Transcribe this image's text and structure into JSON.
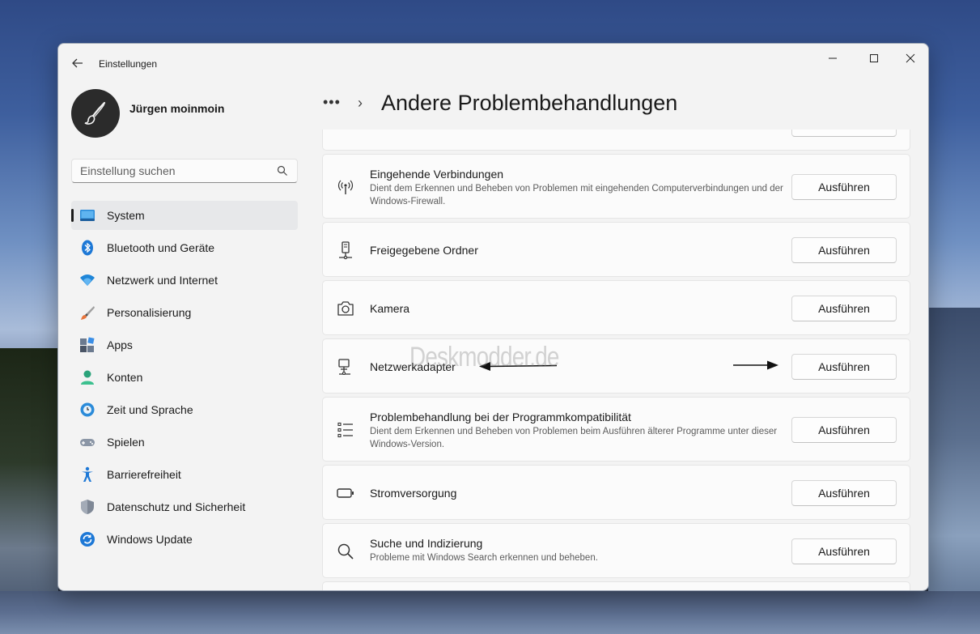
{
  "window": {
    "app_title": "Einstellungen",
    "controls": {
      "minimize": "—",
      "maximize": "☐",
      "close": "✕"
    }
  },
  "profile": {
    "name": "Jürgen moinmoin"
  },
  "search": {
    "placeholder": "Einstellung suchen"
  },
  "nav": {
    "items": [
      {
        "label": "System",
        "icon": "system-icon",
        "selected": true
      },
      {
        "label": "Bluetooth und Geräte",
        "icon": "bluetooth-icon"
      },
      {
        "label": "Netzwerk und Internet",
        "icon": "wifi-icon"
      },
      {
        "label": "Personalisierung",
        "icon": "brush-icon"
      },
      {
        "label": "Apps",
        "icon": "apps-icon"
      },
      {
        "label": "Konten",
        "icon": "account-icon"
      },
      {
        "label": "Zeit und Sprache",
        "icon": "clock-globe-icon"
      },
      {
        "label": "Spielen",
        "icon": "gamepad-icon"
      },
      {
        "label": "Barrierefreiheit",
        "icon": "accessibility-icon"
      },
      {
        "label": "Datenschutz und Sicherheit",
        "icon": "shield-icon"
      },
      {
        "label": "Windows Update",
        "icon": "update-icon"
      }
    ]
  },
  "header": {
    "breadcrumb_more": "•••",
    "breadcrumb_separator": "›",
    "title": "Andere Problembehandlungen"
  },
  "troubleshooters": [
    {
      "title": "Eingehende Verbindungen",
      "description": "Dient dem Erkennen und Beheben von Problemen mit eingehenden Computerverbindungen und der Windows-Firewall.",
      "icon": "antenna-icon",
      "button": "Ausführen"
    },
    {
      "title": "Freigegebene Ordner",
      "description": "",
      "icon": "shared-folder-icon",
      "button": "Ausführen"
    },
    {
      "title": "Kamera",
      "description": "",
      "icon": "camera-icon",
      "button": "Ausführen"
    },
    {
      "title": "Netzwerkadapter",
      "description": "",
      "icon": "network-adapter-icon",
      "button": "Ausführen"
    },
    {
      "title": "Problembehandlung bei der Programmkompatibilität",
      "description": "Dient dem Erkennen und Beheben von Problemen beim Ausführen älterer Programme unter dieser Windows-Version.",
      "icon": "list-icon",
      "button": "Ausführen"
    },
    {
      "title": "Stromversorgung",
      "description": "",
      "icon": "battery-icon",
      "button": "Ausführen"
    },
    {
      "title": "Suche und Indizierung",
      "description": "Probleme mit Windows Search erkennen und beheben.",
      "icon": "search-icon",
      "button": "Ausführen"
    }
  ],
  "watermark": "Deskmodder.de",
  "colors": {
    "accent": "#0067c0",
    "window_bg": "#f3f3f3",
    "card_bg": "#fbfbfb"
  }
}
